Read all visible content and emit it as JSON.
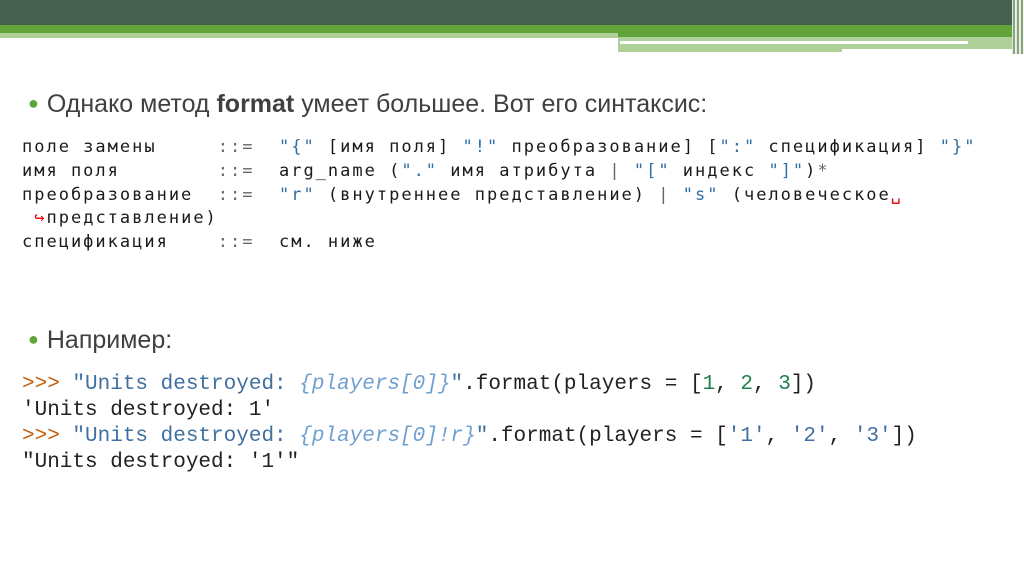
{
  "bullets": [
    {
      "pre": "Однако метод ",
      "bold": "format",
      "post": " умеет большее. Вот его синтаксис:"
    },
    {
      "text": "Например:"
    }
  ],
  "grammar": {
    "l1": {
      "name": "поле замены     ",
      "op": "::=",
      "a": "\"{\"",
      "b": " [имя поля] ",
      "c": "\"!\"",
      "d": " преобразование] [",
      "e": "\":\"",
      "f": " спецификация] ",
      "g": "\"}\""
    },
    "l2": {
      "name": "имя поля        ",
      "op": "::=",
      "a": "arg_name (",
      "b": "\".\"",
      "c": " имя атрибута ",
      "d": "|",
      "e": " ",
      "f": "\"[\"",
      "g": " индекс ",
      "h": "\"]\"",
      "i": ")",
      "j": "*"
    },
    "l3": {
      "name": "преобразование  ",
      "op": "::=",
      "a": "\"r\"",
      "b": " (внутреннее представление) ",
      "c": "|",
      "d": " ",
      "e": "\"s\"",
      "f": " (человеческое",
      "g": "␣"
    },
    "l4": {
      "arrow": "↪",
      "text": "представление)"
    },
    "l5": {
      "name": "спецификация    ",
      "op": "::=",
      "a": "см. ниже"
    }
  },
  "examples": [
    {
      "prompt": ">>>",
      "s1": " \"Units destroyed: ",
      "it": "{players[0]}",
      "s2": "\"",
      "rest": ".format(players = [",
      "n1": "1",
      "c1": ", ",
      "n2": "2",
      "c2": ", ",
      "n3": "3",
      "end": "])"
    },
    {
      "output": "'Units destroyed: 1'"
    },
    {
      "prompt": ">>>",
      "s1": " \"Units destroyed: ",
      "it": "{players[0]!r}",
      "s2": "\"",
      "rest": ".format(players = [",
      "n1": "'1'",
      "c1": ", ",
      "n2": "'2'",
      "c2": ", ",
      "n3": "'3'",
      "end": "])"
    },
    {
      "output": "\"Units destroyed: '1'\""
    }
  ]
}
